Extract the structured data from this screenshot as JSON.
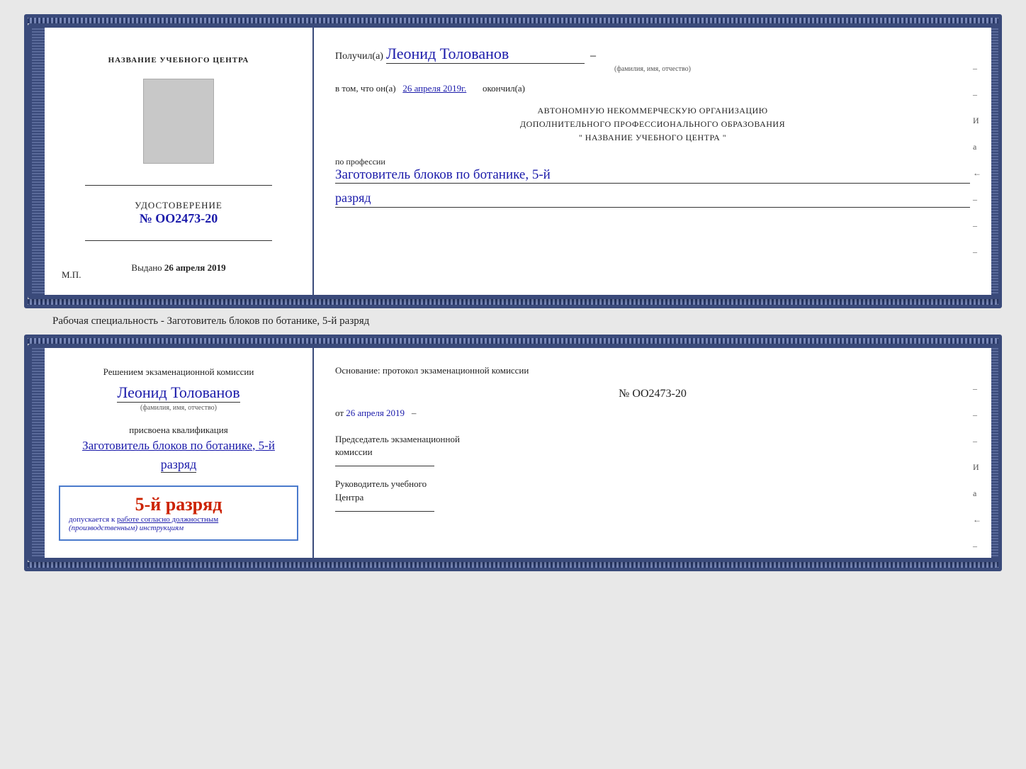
{
  "top_cert": {
    "left": {
      "title": "НАЗВАНИЕ УЧЕБНОГО ЦЕНТРА",
      "cert_label": "УДОСТОВЕРЕНИЕ",
      "cert_number": "№ OO2473-20",
      "issued_label": "Выдано",
      "issued_date": "26 апреля 2019",
      "mp_label": "М.П."
    },
    "right": {
      "received_label": "Получил(а)",
      "name_handwritten": "Леонид Толованов",
      "name_subtitle": "(фамилия, имя, отчество)",
      "date_prefix": "в том, что он(а)",
      "date_handwritten": "26 апреля 2019г.",
      "date_suffix": "окончил(а)",
      "institution_lines": [
        "АВТОНОМНУЮ НЕКОММЕРЧЕСКУЮ ОРГАНИЗАЦИЮ",
        "ДОПОЛНИТЕЛЬНОГО ПРОФЕССИОНАЛЬНОГО ОБРАЗОВАНИЯ",
        "\"  НАЗВАНИЕ УЧЕБНОГО ЦЕНТРА  \""
      ],
      "profession_label": "по профессии",
      "profession_handwritten": "Заготовитель блоков по ботанике, 5-й",
      "rank_handwritten": "разряд",
      "edge_marks": [
        "–",
        "–",
        "И",
        "а",
        "←",
        "–",
        "–",
        "–"
      ]
    }
  },
  "specialty_label": "Рабочая специальность - Заготовитель блоков по ботанике, 5-й разряд",
  "bottom_cert": {
    "left": {
      "decision_text": "Решением экзаменационной комиссии",
      "name_handwritten": "Леонид Толованов",
      "name_subtitle": "(фамилия, имя, отчество)",
      "qualification_label": "присвоена квалификация",
      "profession_handwritten": "Заготовитель блоков по ботанике, 5-й",
      "rank_handwritten": "разряд",
      "stamp_rank": "5-й разряд",
      "stamp_admission": "допускается к",
      "stamp_admission_underline": "работе согласно должностным",
      "stamp_admission_italic": "(производственным) инструкциям"
    },
    "right": {
      "basis_text": "Основание: протокол экзаменационной комиссии",
      "number_line": "№  OO2473-20",
      "date_prefix": "от",
      "date_value": "26 апреля 2019",
      "chairman_title": "Председатель экзаменационной",
      "chairman_title2": "комиссии",
      "director_title": "Руководитель учебного",
      "director_title2": "Центра",
      "edge_marks": [
        "–",
        "–",
        "–",
        "И",
        "а",
        "←",
        "–",
        "–",
        "–"
      ]
    }
  }
}
